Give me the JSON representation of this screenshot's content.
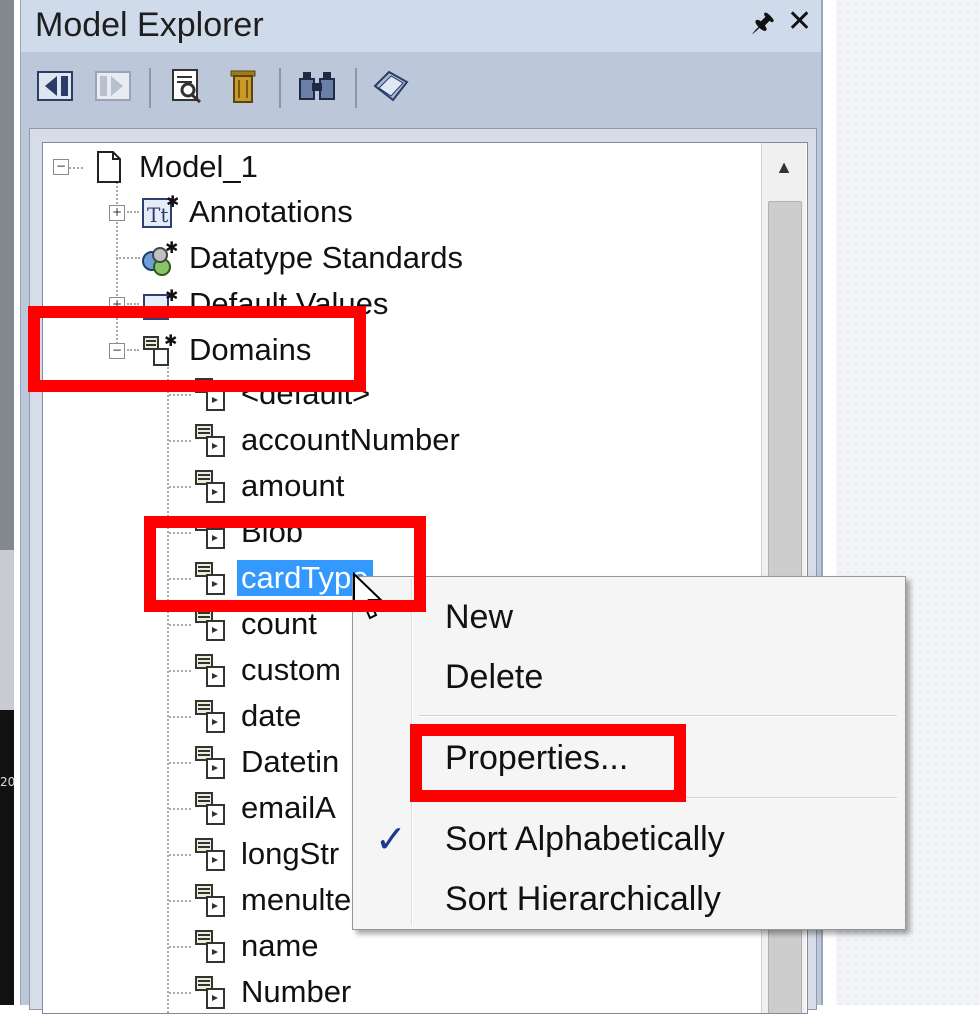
{
  "panel": {
    "title": "Model Explorer",
    "pin_icon": "pin-icon",
    "close_icon": "close-icon"
  },
  "toolbar": {
    "buttons": [
      "collapse-left-icon",
      "expand-right-icon",
      "preview-icon",
      "delete-icon",
      "find-icon",
      "tag-icon"
    ]
  },
  "tree": {
    "root": "Model_1",
    "nodes": {
      "annotations": "Annotations",
      "datatype_standards": "Datatype Standards",
      "default_values": "Default Values",
      "domains": "Domains"
    },
    "domain_items": [
      "<default>",
      "accountNumber",
      "amount",
      "Blob",
      "cardType",
      "count",
      "custom",
      "date",
      "Datetin",
      "emailA",
      "longStr",
      "menulte",
      "name",
      "Number"
    ],
    "selected": "cardType"
  },
  "context_menu": {
    "new": "New",
    "delete": "Delete",
    "properties": "Properties...",
    "sort_alpha": "Sort Alphabetically",
    "sort_hier": "Sort Hierarchically",
    "checked_item": "Sort Alphabetically"
  },
  "left_strip_text": "20",
  "colors": {
    "selection": "#3399ff",
    "annotation": "#ff0000",
    "panel_bg": "#bcc7d9"
  }
}
